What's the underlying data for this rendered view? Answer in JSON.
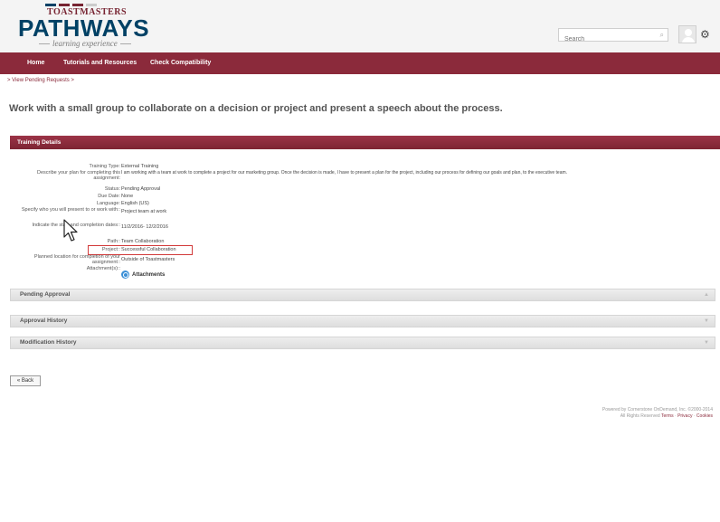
{
  "brand": {
    "colors": {
      "maroon": "#8b2a3b",
      "navy": "#004165",
      "bar_gray": "#cccccc"
    },
    "top_text": "TOASTMASTERS",
    "main_text": "PATHWAYS",
    "sub_text": "learning experience"
  },
  "header": {
    "search_placeholder": "Search",
    "search_icon": "search-icon",
    "avatar_icon": "user-avatar-icon",
    "settings_icon": "gear-icon",
    "settings_glyph": "⚙"
  },
  "nav": {
    "items": [
      {
        "label": "Home"
      },
      {
        "label": "Tutorials and Resources"
      },
      {
        "label": "Check Compatibility"
      }
    ]
  },
  "breadcrumb": {
    "text": "> View Pending Requests >"
  },
  "page": {
    "title": "Work with a small group to collaborate on a decision or project and present a speech about the process."
  },
  "training_details": {
    "header": "Training Details",
    "fields": [
      {
        "label": "Training Type:",
        "value": "External Training"
      },
      {
        "label": "Describe your plan for completing this assignment:",
        "value": "I am working with a team at work to complete a project for our marketing group. Once the decision is made, I have to present a plan for the project, including our process for defining our goals and plan, to the executive team."
      },
      {
        "label": "Status:",
        "value": "Pending Approval"
      },
      {
        "label": "Due Date:",
        "value": "None"
      },
      {
        "label": "Language:",
        "value": "English (US)"
      },
      {
        "label": "Specify who you will present to or work with::",
        "value": "Project team at work"
      },
      {
        "label": "Indicate the start and completion dates::",
        "value": "11/2/2016- 12/2/2016"
      },
      {
        "label": "Path::",
        "value": "Team Collaboration"
      },
      {
        "label": "Project::",
        "value": "Successful Collaboration"
      },
      {
        "label": "Planned location for completion of your assignment::",
        "value": "Outside of Toastmasters"
      },
      {
        "label": "Attachment(s)::",
        "value": "Attachments"
      }
    ]
  },
  "sections": {
    "pending_approval": "Pending Approval",
    "approval_history": "Approval History",
    "modification_history": "Modification History"
  },
  "back_button": "« Back",
  "footer": {
    "line1": "Powered by Cornerstone OnDemand, Inc. ©2000-2014",
    "line2_prefix": "All Rights Reserved",
    "links": [
      "Terms",
      "Privacy",
      "Cookies"
    ]
  }
}
